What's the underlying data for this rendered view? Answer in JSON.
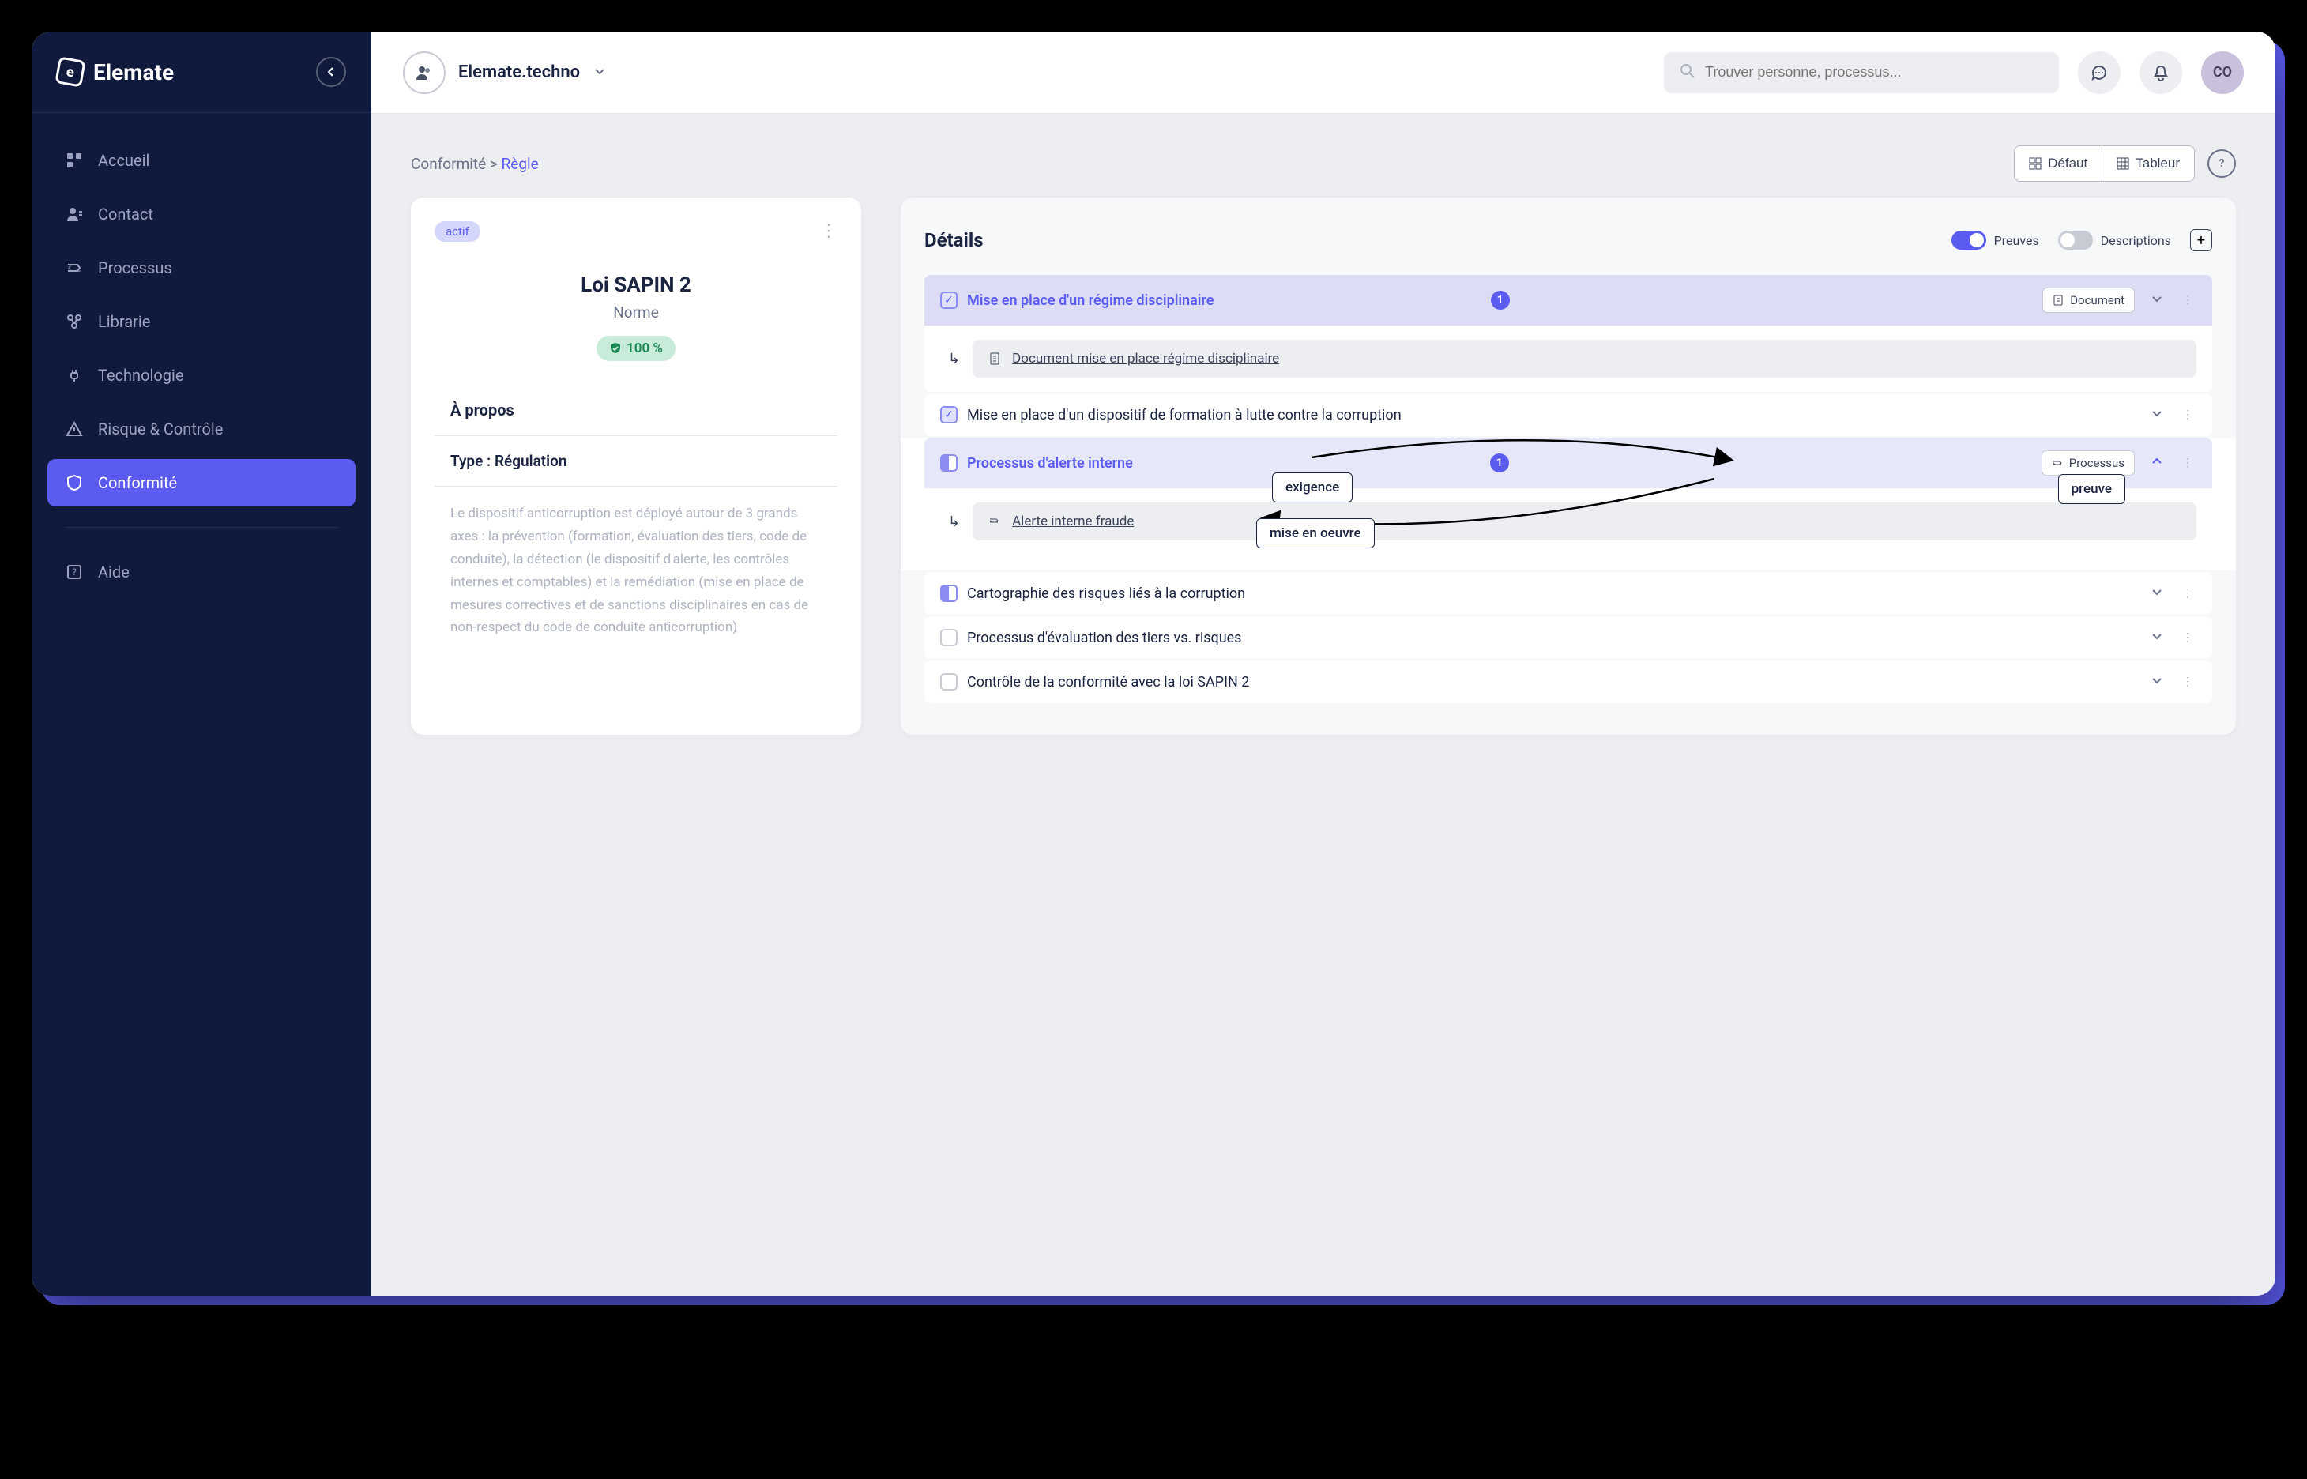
{
  "app_name": "Elemate",
  "org_name": "Elemate.techno",
  "search_placeholder": "Trouver personne, processus...",
  "user_initials": "CO",
  "nav": {
    "accueil": "Accueil",
    "contact": "Contact",
    "processus": "Processus",
    "librarie": "Librarie",
    "technologie": "Technologie",
    "risque": "Risque & Contrôle",
    "conformite": "Conformité",
    "aide": "Aide"
  },
  "breadcrumb": {
    "root": "Conformité",
    "sep": ">",
    "current": "Règle"
  },
  "views": {
    "default": "Défaut",
    "table": "Tableur"
  },
  "info": {
    "status": "actif",
    "title": "Loi SAPIN 2",
    "subtitle": "Norme",
    "progress": "100 %",
    "about_label": "À propos",
    "type_label": "Type :",
    "type_value": "Régulation",
    "description": "Le dispositif anticorruption est déployé autour de 3 grands axes : la prévention (formation, évaluation des tiers, code de conduite), la détection (le dispositif d'alerte, les contrôles internes et comptables) et la remédiation (mise en place de mesures correctives et de sanctions disciplinaires en cas de non-respect du code de conduite anticorruption)"
  },
  "details": {
    "title": "Détails",
    "toggles": {
      "preuves": "Preuves",
      "descriptions": "Descriptions"
    },
    "tag_document": "Document",
    "tag_processus": "Processus",
    "requirements": [
      {
        "title": "Mise en place d'un régime disciplinaire",
        "count": "1",
        "evidence": "Document mise en place régime disciplinaire"
      },
      {
        "title": "Mise en place d'un dispositif de formation à lutte contre la corruption"
      },
      {
        "title": "Processus d'alerte interne",
        "count": "1",
        "evidence": "Alerte interne fraude"
      },
      {
        "title": "Cartographie des risques liés à la corruption"
      },
      {
        "title": "Processus d'évaluation des tiers vs. risques"
      },
      {
        "title": "Contrôle de la conformité avec la loi SAPIN 2"
      }
    ]
  },
  "annotations": {
    "exigence": "exigence",
    "preuve": "preuve",
    "mise_en_oeuvre": "mise en oeuvre"
  }
}
